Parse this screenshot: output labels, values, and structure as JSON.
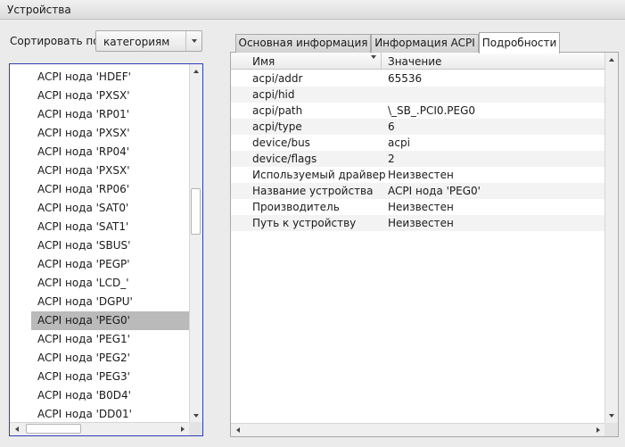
{
  "window": {
    "title": "Устройства"
  },
  "sort": {
    "label": "Сортировать по:",
    "selected": "категориям"
  },
  "device_tree": {
    "items": [
      {
        "label": "ACPI нода 'HDEF'"
      },
      {
        "label": "ACPI нода 'PXSX'"
      },
      {
        "label": "ACPI нода 'RP01'"
      },
      {
        "label": "ACPI нода 'PXSX'"
      },
      {
        "label": "ACPI нода 'RP04'"
      },
      {
        "label": "ACPI нода 'PXSX'"
      },
      {
        "label": "ACPI нода 'RP06'"
      },
      {
        "label": "ACPI нода 'SAT0'"
      },
      {
        "label": "ACPI нода 'SAT1'"
      },
      {
        "label": "ACPI нода 'SBUS'"
      },
      {
        "label": "ACPI нода 'PEGP'"
      },
      {
        "label": "ACPI нода 'LCD_'"
      },
      {
        "label": "ACPI нода 'DGPU'"
      },
      {
        "label": "ACPI нода 'PEG0'",
        "selected": true
      },
      {
        "label": "ACPI нода 'PEG1'"
      },
      {
        "label": "ACPI нода 'PEG2'"
      },
      {
        "label": "ACPI нода 'PEG3'"
      },
      {
        "label": "ACPI нода 'B0D4'"
      },
      {
        "label": "ACPI нода 'DD01'"
      }
    ]
  },
  "tabs": [
    {
      "label": "Основная информация",
      "active": false
    },
    {
      "label": "Информация ACPI",
      "active": false
    },
    {
      "label": "Подробности",
      "active": true
    }
  ],
  "details": {
    "columns": {
      "name": "Имя",
      "value": "Значение"
    },
    "rows": [
      {
        "name": "acpi/addr",
        "value": "65536"
      },
      {
        "name": "acpi/hid",
        "value": ""
      },
      {
        "name": "acpi/path",
        "value": "\\_SB_.PCI0.PEG0"
      },
      {
        "name": "acpi/type",
        "value": "6"
      },
      {
        "name": "device/bus",
        "value": "acpi"
      },
      {
        "name": "device/flags",
        "value": "2"
      },
      {
        "name": "Используемый драйвер",
        "value": "Неизвестен"
      },
      {
        "name": "Название устройства",
        "value": "ACPI нода 'PEG0'"
      },
      {
        "name": "Производитель",
        "value": "Неизвестен"
      },
      {
        "name": "Путь к устройству",
        "value": "Неизвестен"
      }
    ]
  },
  "colors": {
    "selection": "#bababa",
    "list_border": "#2e3db2",
    "background": "#ebebeb"
  }
}
